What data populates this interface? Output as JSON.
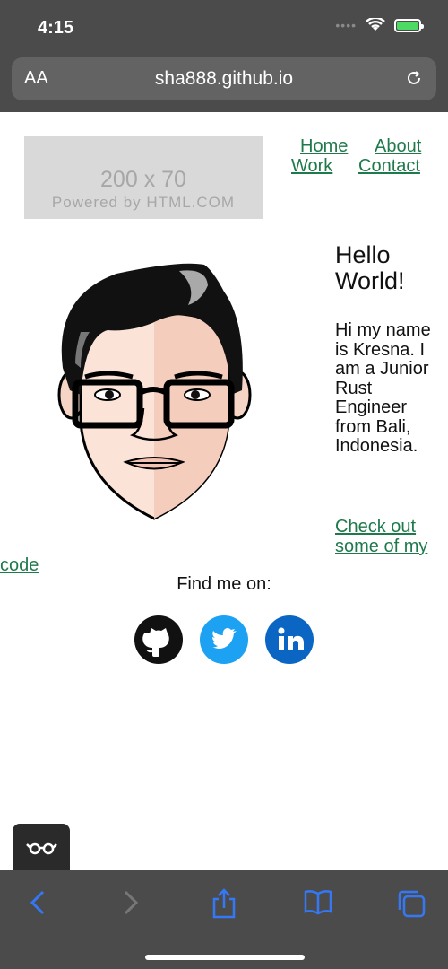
{
  "status_bar": {
    "time": "4:15",
    "signal_dots": "••••"
  },
  "browser": {
    "text_size_label": "AA",
    "url": "sha888.github.io"
  },
  "page": {
    "banner": {
      "dimensions": "200 x 70",
      "powered_by": "Powered by HTML.COM"
    },
    "nav": [
      {
        "label": "Home"
      },
      {
        "label": "About"
      },
      {
        "label": "Work"
      },
      {
        "label": "Contact"
      }
    ],
    "hello": [
      "Hello",
      "World!"
    ],
    "bio": "Hi my name is Kresna. I am a Junior Rust Engineer from Bali, Indonesia.",
    "check_out_lines": [
      "Check out",
      "some of my",
      "code"
    ],
    "find_me": "Find me on:",
    "social": [
      {
        "name": "github",
        "icon": "github-icon",
        "color": "#111111"
      },
      {
        "name": "twitter",
        "icon": "twitter-icon",
        "color": "#1da1f2"
      },
      {
        "name": "linkedin",
        "icon": "linkedin-icon",
        "color": "#0a66c2"
      }
    ]
  },
  "colors": {
    "link": "#1f7a4b",
    "chrome": "#4b4b4b",
    "toolbar_icon": "#3478f6"
  }
}
